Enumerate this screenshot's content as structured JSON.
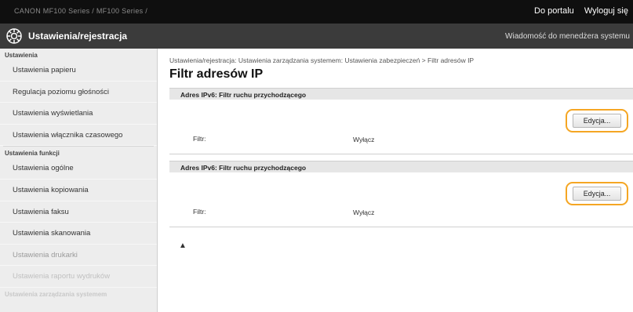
{
  "topbar": {
    "device": "CANON   MF100 Series / MF100 Series /",
    "portal_link": "Do portalu",
    "logout_link": "Wyloguj się"
  },
  "titlebar": {
    "title": "Ustawienia/rejestracja",
    "admin_message": "Wiadomość do menedżera systemu"
  },
  "sidebar": {
    "group1_title": "Ustawienia",
    "group1_items": [
      "Ustawienia papieru",
      "Regulacja poziomu głośności",
      "Ustawienia wyświetlania",
      "Ustawienia włącznika czasowego"
    ],
    "group2_title": "Ustawienia funkcji",
    "group2_items": [
      "Ustawienia ogólne",
      "Ustawienia kopiowania",
      "Ustawienia faksu",
      "Ustawienia skanowania",
      "Ustawienia drukarki",
      "Ustawienia raportu wydruków"
    ],
    "group3_title": "Ustawienia zarządzania systemem"
  },
  "main": {
    "breadcrumb": "Ustawienia/rejestracja: Ustawienia zarządzania systemem: Ustawienia zabezpieczeń > Filtr adresów IP",
    "page_title": "Filtr adresów IP",
    "sections": [
      {
        "heading": "Adres IPv6: Filtr ruchu przychodzącego",
        "edit_label": "Edycja...",
        "filter_label": "Filtr:",
        "filter_value": "Wyłącz"
      },
      {
        "heading": "Adres IPv6: Filtr ruchu przychodzącego",
        "edit_label": "Edycja...",
        "filter_label": "Filtr:",
        "filter_value": "Wyłącz"
      }
    ],
    "top_link": "▲"
  },
  "colors": {
    "highlight": "#f5a623",
    "topbar": "#0f0f0f",
    "titlebar": "#3b3b3b"
  }
}
